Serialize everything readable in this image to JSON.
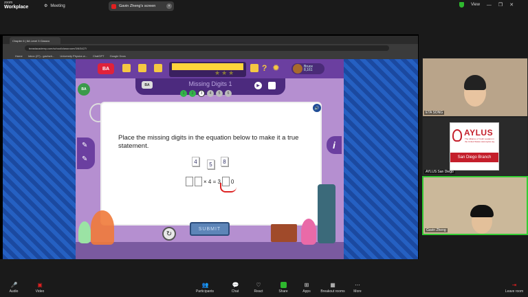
{
  "zoom": {
    "brand_top": "zoom",
    "brand_bottom": "Workplace",
    "meeting_label": "Meeting",
    "share_label": "Gavin Zheng's screen",
    "view_label": "View"
  },
  "browser": {
    "tab_title": "Chapter 6 | 6A Level 3 Classro",
    "url": "beastacademy.com/school/classroom/3/6/3427/",
    "bookmarks": [
      "Home",
      "Inbox (27) - gavinzh...",
      "University Physics w...",
      "ChatGPT",
      "Google Docs"
    ]
  },
  "game": {
    "logo": "BA",
    "side_logo": "BA",
    "title": "Missing Digits 1",
    "progress_dots": [
      "1",
      "2",
      "3",
      "4",
      "5",
      "6"
    ],
    "player_name": "Bruce",
    "player_score": "8,161",
    "question": "Place the missing digits in the equation below to make it a true statement.",
    "tiles": [
      "4",
      "5",
      "8"
    ],
    "equation_times": "× 4 = 3",
    "equation_end": "0",
    "submit_label": "SUBMIT",
    "info_label": "i",
    "title_logo": "BA"
  },
  "videos": [
    {
      "label": "ETA SONG"
    },
    {
      "label": "AYLUS San Diego"
    },
    {
      "label": "Gavin Zheng"
    }
  ],
  "aylus": {
    "name": "AYLUS",
    "tagline": "The Alliance of Youth Leaders in the United States",
    "site": "www.aylus.org",
    "branch": "San Diego Branch"
  },
  "toolbar": [
    {
      "id": "audio",
      "label": "Audio"
    },
    {
      "id": "video",
      "label": "Video"
    },
    {
      "id": "participants",
      "label": "Participants",
      "count": "3"
    },
    {
      "id": "chat",
      "label": "Chat"
    },
    {
      "id": "react",
      "label": "React"
    },
    {
      "id": "share",
      "label": "Share"
    },
    {
      "id": "apps",
      "label": "Apps"
    },
    {
      "id": "breakout",
      "label": "Breakout rooms"
    },
    {
      "id": "more",
      "label": "More"
    },
    {
      "id": "leave",
      "label": "Leave room"
    }
  ],
  "colors": {
    "zoom_bg": "#1a1a1a",
    "game_purple": "#6b3fa0",
    "game_bg": "#b58fd0",
    "pattern_blue": "#1e4fa8",
    "done_green": "#33b54a",
    "share_green": "#2eb82e",
    "leave_red": "#e02020"
  }
}
